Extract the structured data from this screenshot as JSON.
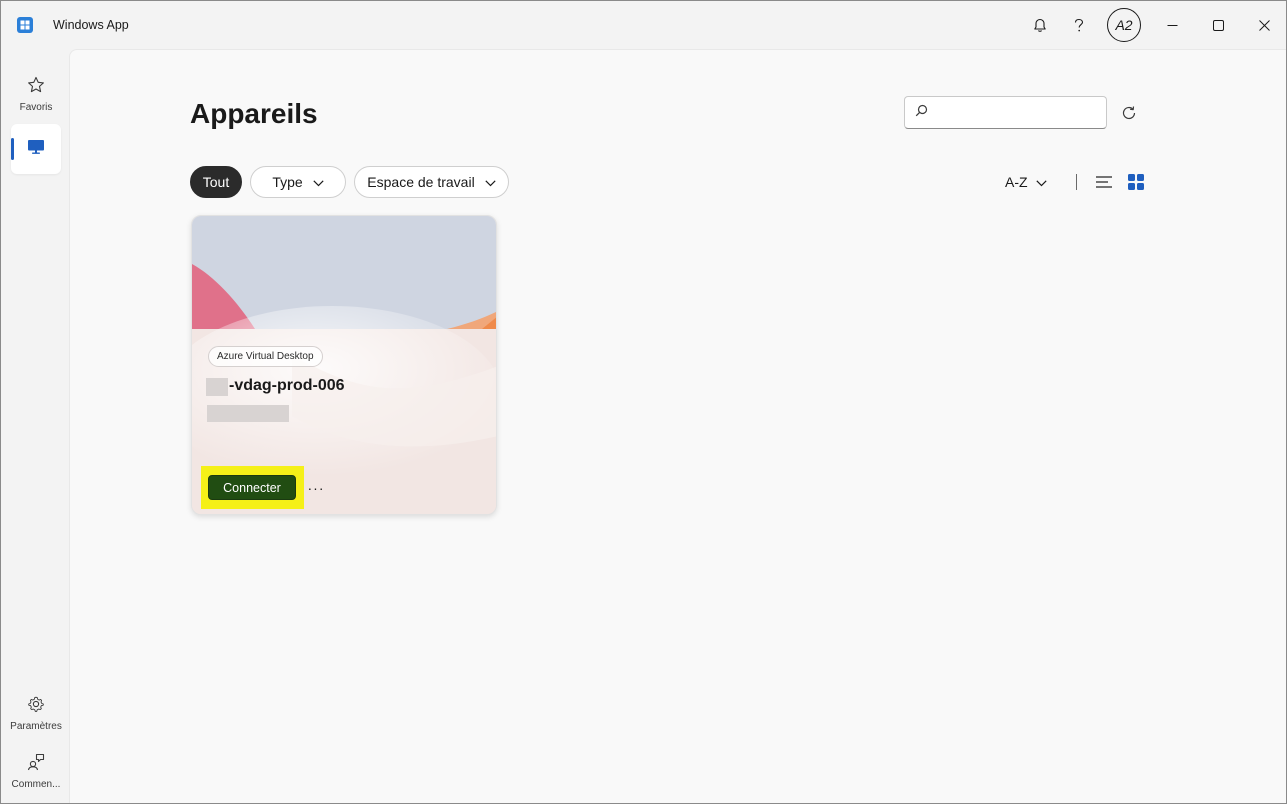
{
  "app": {
    "title": "Windows App",
    "avatar_initials": "A2",
    "accent_color": "#1f5fbf"
  },
  "sidebar": {
    "items": [
      {
        "label": "Favoris",
        "icon": "star-icon"
      },
      {
        "label": "",
        "icon": "monitor-icon",
        "selected": true
      },
      {
        "label": "Paramètres",
        "icon": "gear-icon"
      },
      {
        "label": "Commen...",
        "icon": "feedback-icon"
      }
    ]
  },
  "main": {
    "title": "Appareils",
    "search": {
      "placeholder": "",
      "value": ""
    },
    "filters": {
      "all": "Tout",
      "type": "Type",
      "workspace": "Espace de travail"
    },
    "sort": {
      "label": "A-Z"
    },
    "view_mode": "grid"
  },
  "device_card": {
    "badge": "Azure Virtual Desktop",
    "name": "-vdag-prod-006",
    "connect_label": "Connecter",
    "more_label": "···",
    "highlight_color": "#f5f018",
    "button_color": "#214d12"
  }
}
